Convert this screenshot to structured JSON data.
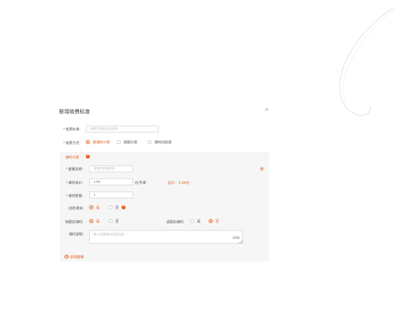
{
  "dialog": {
    "title": "新增收费标准",
    "close_label": "×"
  },
  "fee_standard": {
    "label": "收费标准:",
    "placeholder": "请填写收费标准名称"
  },
  "fee_mode": {
    "label": "收费方式:",
    "options": [
      "按课时计费",
      "按期计费",
      "按时间收费"
    ],
    "selected": "按课时计费"
  },
  "panel": {
    "title": "课时计费",
    "delete_label": "删",
    "package_name": {
      "label": "套餐名称:",
      "placeholder": "请填写套餐名称"
    },
    "unit_price": {
      "label": "课时单价:",
      "value": "1.00",
      "unit": "元/节课"
    },
    "total_price": {
      "label": "总价:",
      "value": "1.00元"
    },
    "lesson_count": {
      "label": "课时数量:",
      "value": "1"
    },
    "dynamic_deduct": {
      "label": "动态课消:",
      "options": [
        "是",
        "否"
      ],
      "selected": "是"
    },
    "absence_deduct": {
      "label": "缺勤扣课时:",
      "options": [
        "是",
        "否"
      ],
      "selected": "是"
    },
    "leave_deduct": {
      "label": "请假扣课时:",
      "options": [
        "是",
        "否"
      ],
      "selected": "否"
    },
    "description": {
      "label": "课时说明:",
      "placeholder": "输入套餐课时说明内容",
      "counter": "0/50"
    },
    "add_package_label": "添加套餐"
  },
  "colors": {
    "accent": "#e85a1b",
    "panel_bg": "#f6f6f6",
    "border": "#dcdcdc"
  }
}
